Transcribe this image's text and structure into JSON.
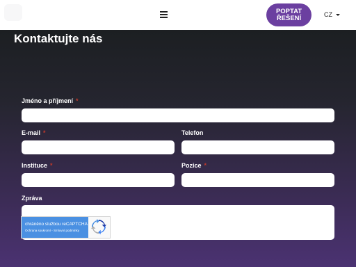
{
  "header": {
    "cta_label": "POPTAT ŘEŠENÍ",
    "language": "CZ"
  },
  "contact": {
    "title": "Kontaktujte nás",
    "fields": {
      "name": {
        "label": "Jméno a příjmení",
        "required_mark": "*",
        "value": ""
      },
      "email": {
        "label": "E-mail",
        "required_mark": "*",
        "value": ""
      },
      "phone": {
        "label": "Telefon",
        "value": ""
      },
      "institution": {
        "label": "Instituce",
        "required_mark": "*",
        "value": ""
      },
      "position": {
        "label": "Pozice",
        "required_mark": "*",
        "value": ""
      },
      "message": {
        "label": "Zpráva",
        "value": ""
      }
    },
    "recaptcha": {
      "text": "chráněno službou reCAPTCHA",
      "links": "Ochrana soukromí - Smluvní podmínky"
    }
  },
  "colors": {
    "accent": "#6b3fa0",
    "header_bg": "#ffffff",
    "required": "#c0392b"
  }
}
